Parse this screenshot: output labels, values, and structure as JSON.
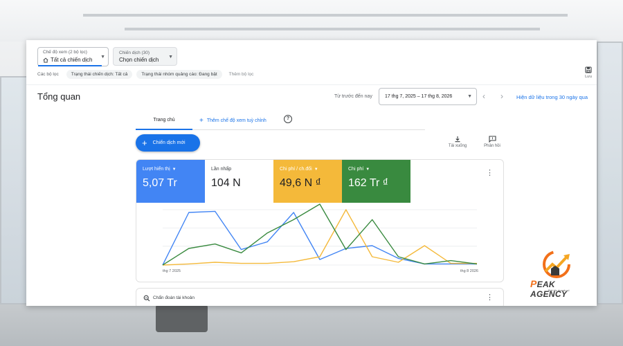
{
  "toolbar": {
    "view_select": {
      "sublabel": "Chế độ xem (2 bộ lọc)",
      "value": "Tất cả chiến dịch"
    },
    "campaign_select": {
      "sublabel": "Chiến dịch (30)",
      "value": "Chọn chiến dịch"
    },
    "filters": {
      "label": "Các bộ lọc",
      "chips": [
        "Trạng thái chiến dịch: Tất cả",
        "Trạng thái nhóm quảng cáo: Đang bật"
      ],
      "add_label": "Thêm bộ lọc"
    },
    "save_label": "Lưu"
  },
  "header": {
    "title": "Tổng quan",
    "date_label": "Từ trước đến nay",
    "date_range": "17 thg 7, 2025 – 17 thg 8, 2026",
    "last30_link": "Hiện dữ liệu trong 30 ngày qua"
  },
  "tabs": {
    "home": "Trang chủ",
    "add_custom": "Thêm chế độ xem tuỳ chỉnh"
  },
  "actions": {
    "new_campaign": "Chiến dịch mới",
    "download": "Tải xuống",
    "feedback": "Phản hồi"
  },
  "metrics": [
    {
      "label": "Lượt hiển thị",
      "value": "5,07 Tr",
      "dropdown": true
    },
    {
      "label": "Lần nhấp",
      "value": "104 N",
      "dropdown": false
    },
    {
      "label": "Chi phí / ch.đổi",
      "value": "49,6 N ₫",
      "dropdown": true
    },
    {
      "label": "Chi phí",
      "value": "162 Tr ₫",
      "dropdown": true
    }
  ],
  "chart_data": {
    "type": "line",
    "x_start_label": "thg 7 2025",
    "x_end_label": "thg 8 2026",
    "x": [
      0,
      1,
      2,
      3,
      4,
      5,
      6,
      7,
      8,
      9,
      10,
      11,
      12
    ],
    "ylim": [
      0,
      100
    ],
    "grid": true,
    "series": [
      {
        "color": "#4285f4",
        "values": [
          0,
          95,
          97,
          28,
          42,
          95,
          10,
          30,
          35,
          12,
          2,
          2,
          2
        ]
      },
      {
        "color": "#f4b93a",
        "values": [
          0,
          2,
          5,
          3,
          3,
          6,
          15,
          100,
          15,
          5,
          35,
          3,
          3
        ]
      },
      {
        "color": "#398a3f",
        "values": [
          0,
          30,
          38,
          22,
          58,
          82,
          110,
          28,
          82,
          15,
          2,
          8,
          2
        ]
      }
    ]
  },
  "diagnostics": {
    "label": "Chẩn đoán tài khoản"
  },
  "logo": {
    "brand": "EAK AGENCY",
    "brand_initial": "P",
    "slogan": "Bứt tốc doanh số"
  },
  "colors": {
    "accent": "#1a73e8",
    "impressions": "#4285f4",
    "cpa": "#f4b93a",
    "cost": "#398a3f"
  }
}
